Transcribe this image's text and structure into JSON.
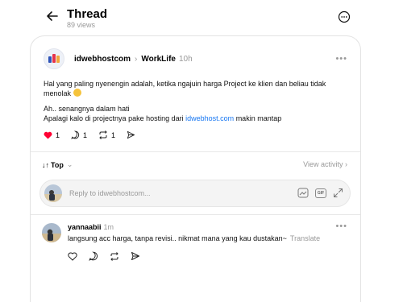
{
  "header": {
    "title": "Thread",
    "views": "89 views"
  },
  "post": {
    "author": "idwebhostcom",
    "community": "WorkLife",
    "time": "10h",
    "line1": "Hal yang paling nyenengin adalah, ketika ngajuin harga Project ke klien dan beliau tidak menolak",
    "line2": "Ah.. senangnya dalam hati",
    "line3_pre": "Apalagi kalo di projectnya pake hosting dari",
    "line3_link": "idwebhost.com",
    "line3_post": "makin mantap",
    "likes": "1",
    "comments": "1",
    "reposts": "1"
  },
  "sort": {
    "label": "Top",
    "view_activity": "View activity"
  },
  "reply": {
    "placeholder": "Reply to idwebhostcom..."
  },
  "comment": {
    "author": "yannaabii",
    "time": "1m",
    "text": "langsung acc harga, tanpa revisi.. nikmat mana yang kau dustakan~",
    "translate": "Translate"
  },
  "colors": {
    "like": "#ff0034",
    "link": "#1877f2",
    "muted": "#999999"
  }
}
